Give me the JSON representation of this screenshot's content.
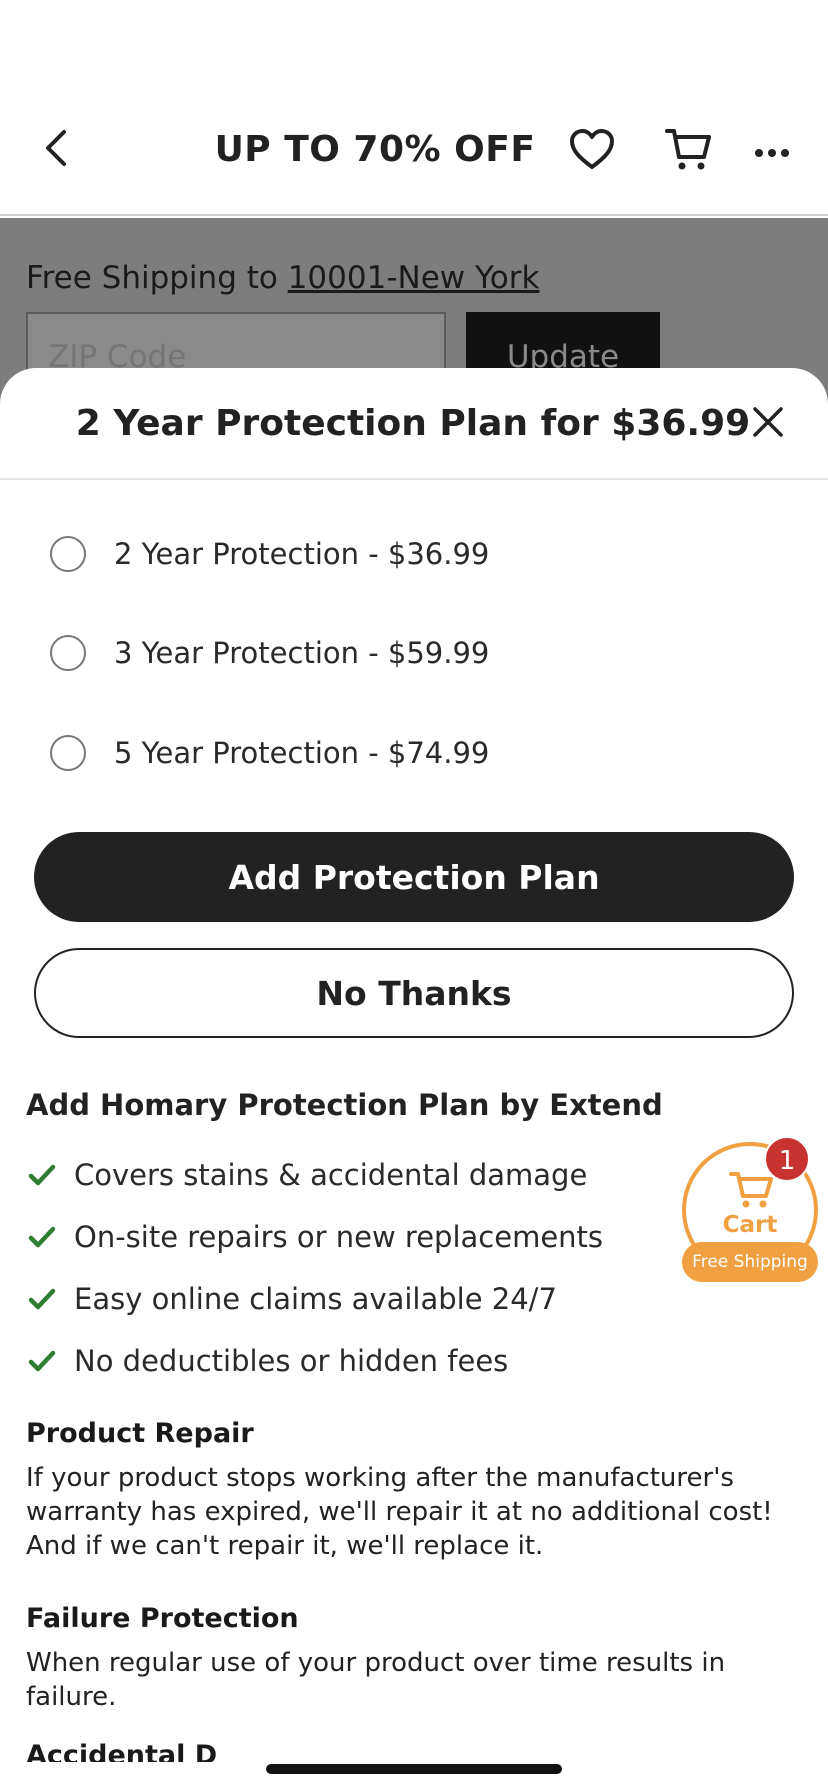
{
  "header": {
    "title": "UP TO 70% OFF",
    "back_icon": "chevron-left-icon",
    "wishlist_icon": "heart-icon",
    "cart_icon": "cart-icon",
    "more_icon": "more-horizontal-icon"
  },
  "background_page": {
    "shipping_prefix": "Free Shipping to ",
    "shipping_location": "10001-New York",
    "zip_placeholder": "ZIP Code",
    "update_label": "Update"
  },
  "sheet": {
    "title": "2 Year Protection Plan for $36.99",
    "close_icon": "close-icon",
    "options": [
      {
        "label": "2 Year Protection - $36.99",
        "selected": false
      },
      {
        "label": "3 Year Protection - $59.99",
        "selected": false
      },
      {
        "label": "5 Year Protection - $74.99",
        "selected": false
      }
    ],
    "add_button_label": "Add Protection Plan",
    "no_thanks_label": "No Thanks",
    "info": {
      "title": "Add Homary Protection Plan by Extend",
      "benefits": [
        "Covers stains & accidental damage",
        "On-site repairs or new replacements",
        "Easy online claims available 24/7",
        "No deductibles or hidden fees"
      ],
      "product_repair_title": "Product Repair",
      "product_repair_body": "If your product stops working after the manufacturer's warranty has expired, we'll repair it at no additional cost! And if we can't repair it, we'll replace it.",
      "failure_protection_title": "Failure Protection",
      "failure_protection_body": "When regular use of your product over time results in failure.",
      "next_section_title": "Accidental D"
    }
  },
  "floating_cart": {
    "label": "Cart",
    "badge_count": "1",
    "free_shipping_label": "Free Shipping",
    "accent_color": "#f0a040",
    "badge_color": "#c8322f"
  },
  "colors": {
    "primary_button": "#222222",
    "check": "#2e7d32",
    "overlay": "#7d7d7d"
  }
}
